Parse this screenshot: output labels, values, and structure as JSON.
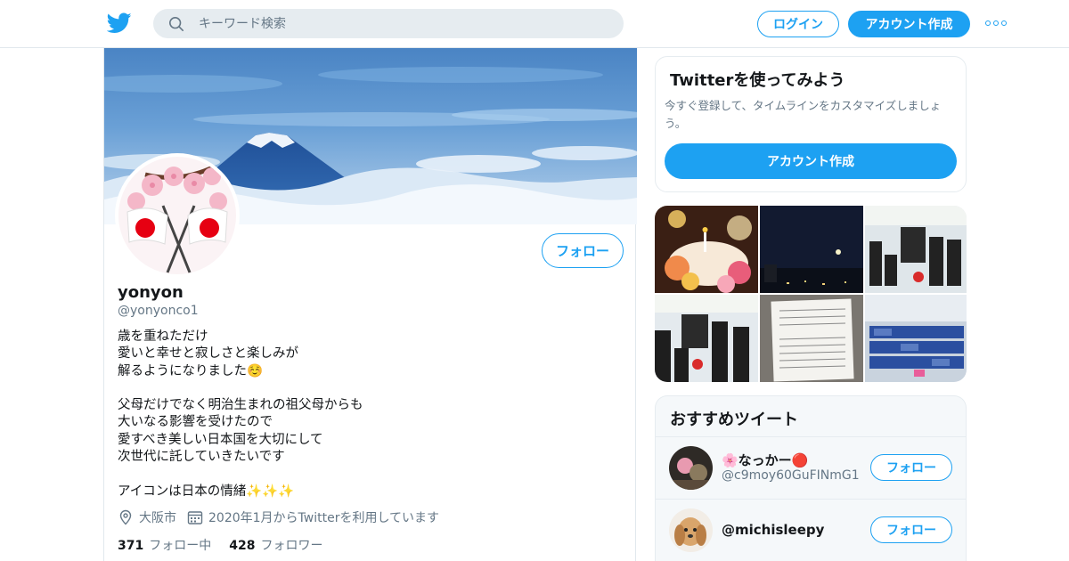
{
  "header": {
    "search_placeholder": "キーワード検索",
    "login_label": "ログイン",
    "signup_label": "アカウント作成",
    "icons": [
      "twitter-bird-icon",
      "search-icon",
      "more-icon"
    ],
    "accent_color": "#1da1f2"
  },
  "profile": {
    "name": "yonyon",
    "handle": "@yonyonco1",
    "follow_label": "フォロー",
    "bio_lines": [
      "歳を重ねただけ",
      "愛いと幸せと寂しさと楽しみが",
      "解るようになりました☺️",
      "",
      "父母だけでなく明治生まれの祖父母からも",
      "大いなる影響を受けたので",
      "愛すべき美しい日本国を大切にして",
      "次世代に託していきたいです",
      "",
      "アイコンは日本の情緒✨✨✨"
    ],
    "location": "大阪市",
    "joined": "2020年1月からTwitterを利用しています",
    "following_count": "371",
    "following_label": "フォロー中",
    "followers_count": "428",
    "followers_label": "フォロワー"
  },
  "signup_card": {
    "title": "Twitterを使ってみよう",
    "description": "今すぐ登録して、タイムラインをカスタマイズしましょう。",
    "button_label": "アカウント作成"
  },
  "recommended": {
    "title": "おすすめツイート",
    "users": [
      {
        "name": "🌸なっかー🔴",
        "handle": "@c9moy60GuFINmG1",
        "follow_label": "フォロー"
      },
      {
        "name": "@michisleepy",
        "handle": "",
        "follow_label": "フォロー"
      }
    ]
  }
}
